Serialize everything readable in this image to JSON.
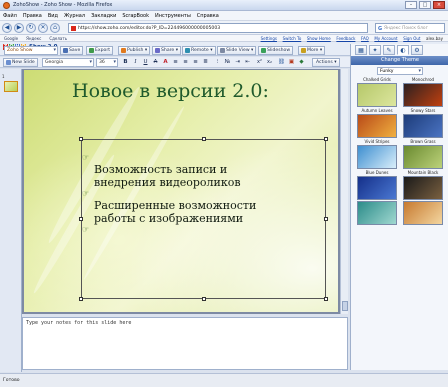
{
  "window": {
    "title": "ZohoShow - Zoho Show - Mozilla Firefox"
  },
  "menu": [
    "Файл",
    "Правка",
    "Вид",
    "Журнал",
    "Закладки",
    "ScrapBook",
    "Инструменты",
    "Справка"
  ],
  "nav": {
    "url": "https://show.zoho.com/editor.do?P_ID=224496000000005003",
    "search_placeholder": "Яндекс Поиск блог"
  },
  "bookmarks": [
    "Google",
    "Яндекс",
    "Сделать"
  ],
  "zoho_links": [
    "Settings",
    "Switch To",
    "Show Home",
    "Feedback",
    "FAQ",
    "My Account",
    "Sign Out",
    "alex.bay"
  ],
  "toolbar": {
    "logo_letters": [
      "Z",
      "O",
      "H",
      "O"
    ],
    "logo_colors": [
      "#d9281c",
      "#2a9a3c",
      "#2a63c8",
      "#f0a619"
    ],
    "app_name": "Show 2.0",
    "slide_name": "Zoho Show",
    "save": "Save",
    "export": "Export",
    "publish": "Publish",
    "share": "Share",
    "remote": "Remote",
    "slide_view": "Slide View",
    "slideshow": "Slideshow",
    "more": "More"
  },
  "format": {
    "new_slide": "New Slide",
    "font": "Georgia",
    "size": "36",
    "actions": "Actions"
  },
  "slide": {
    "number": "1",
    "title": "Новое в версии 2.0:",
    "bullets": [
      "Возможность записи и\nвнедрения видеороликов",
      "Расширенные возможности\nработы с изображениями"
    ]
  },
  "notes_placeholder": "Type your notes for this slide here",
  "panel": {
    "heading": "Change Theme",
    "selected_theme": "Funky",
    "themes": [
      {
        "name": "Chalked Grids",
        "c1": "#b6c86a",
        "c2": "#dce69e"
      },
      {
        "name": "Monochrod",
        "c1": "#2d2020",
        "c2": "#c04010"
      },
      {
        "name": "Autumn Leaves",
        "c1": "#b94b18",
        "c2": "#f0b040"
      },
      {
        "name": "Snowy Stars",
        "c1": "#1d3c7a",
        "c2": "#4a73c2"
      },
      {
        "name": "Vivid Stripes",
        "c1": "#3e8fd0",
        "c2": "#d9eefa"
      },
      {
        "name": "Brown Grass",
        "c1": "#6a8a30",
        "c2": "#bcd27a"
      },
      {
        "name": "Blue Dunes",
        "c1": "#15308a",
        "c2": "#4a78d2"
      },
      {
        "name": "Mountain Black",
        "c1": "#1a1a1a",
        "c2": "#7a6040"
      },
      {
        "name": "",
        "c1": "#2c8c8a",
        "c2": "#a0d8d0"
      },
      {
        "name": "",
        "c1": "#c77a30",
        "c2": "#f3d6a0"
      }
    ]
  },
  "status": "Готово"
}
